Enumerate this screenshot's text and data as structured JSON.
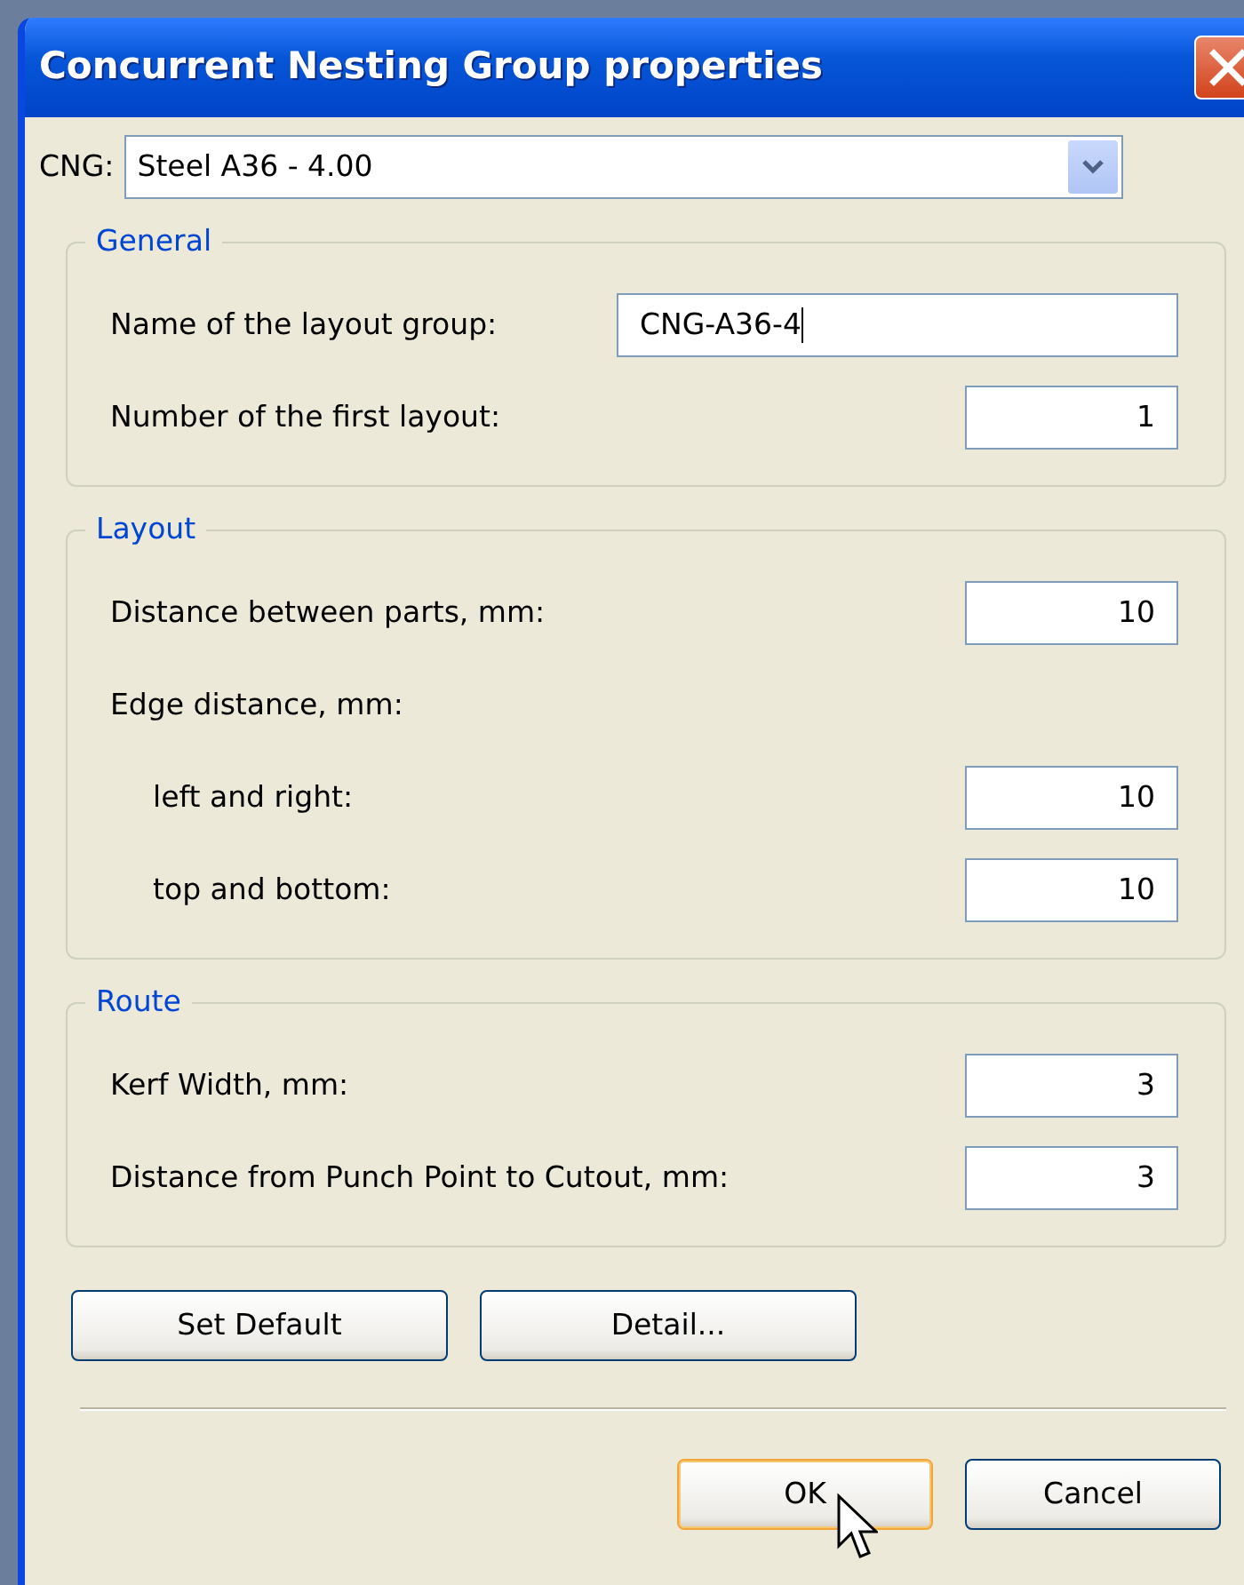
{
  "window": {
    "title": "Concurrent Nesting Group properties"
  },
  "cng": {
    "label": "CNG:",
    "value": "Steel A36 - 4.00"
  },
  "groups": [
    {
      "title": "General",
      "rows": [
        {
          "label": "Name of the layout group:",
          "kind": "text",
          "value": "CNG-A36-4",
          "focused": true
        },
        {
          "label": "Number of the first layout:",
          "kind": "number",
          "value": "1",
          "focused": false
        }
      ]
    },
    {
      "title": "Layout",
      "rows": [
        {
          "label": "Distance between parts, mm:",
          "kind": "number",
          "value": "10",
          "focused": false
        },
        {
          "label": "Edge distance, mm:",
          "kind": "heading",
          "children": [
            {
              "label": "left and right:",
              "kind": "number",
              "value": "10",
              "focused": false
            },
            {
              "label": "top and bottom:",
              "kind": "number",
              "value": "10",
              "focused": false
            }
          ]
        }
      ]
    },
    {
      "title": "Route",
      "rows": [
        {
          "label": "Kerf Width, mm:",
          "kind": "number",
          "value": "3",
          "focused": false
        },
        {
          "label": "Distance from Punch Point to Cutout, mm:",
          "kind": "number",
          "value": "3",
          "focused": false
        }
      ]
    }
  ],
  "tool_buttons": [
    "Set Default",
    "Detail..."
  ],
  "dialog_buttons": [
    {
      "label": "OK",
      "default": true
    },
    {
      "label": "Cancel",
      "default": false
    }
  ]
}
